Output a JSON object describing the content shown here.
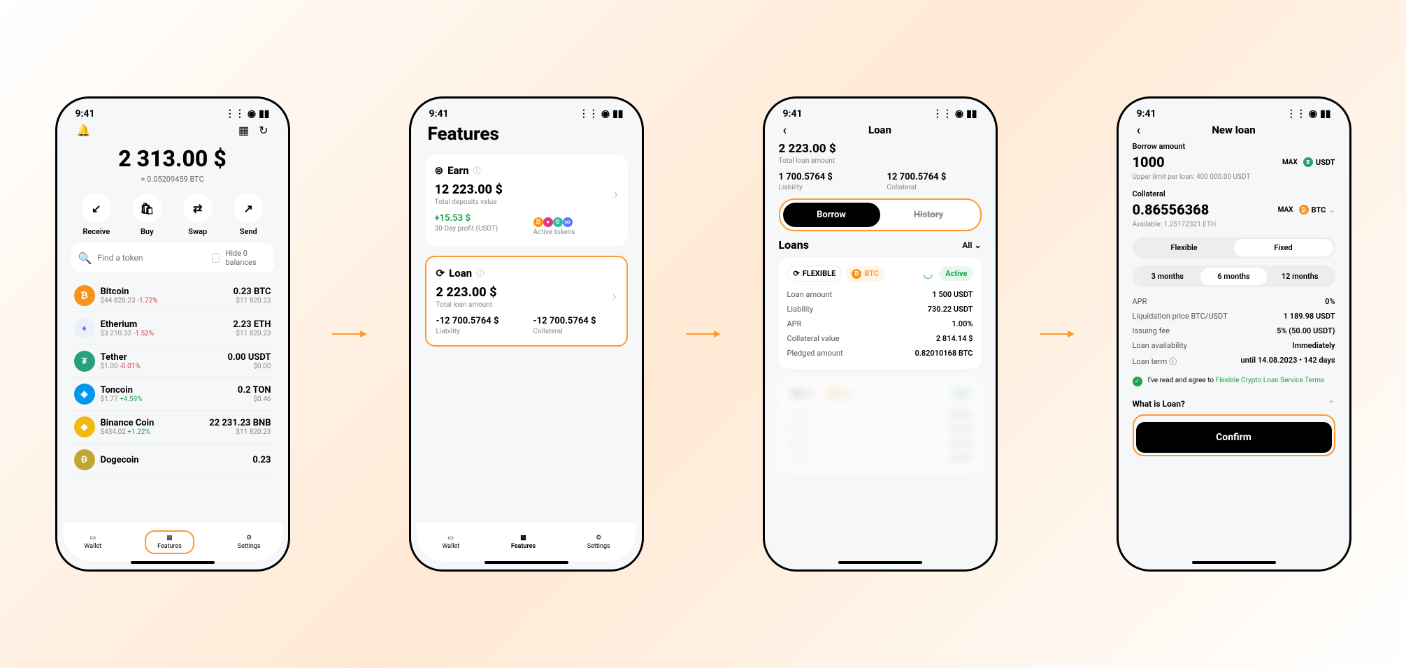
{
  "status": {
    "time": "9:41"
  },
  "wallet": {
    "balance": "2 313.00 $",
    "balance_btc": "≈ 0.05209459 BTC",
    "actions": {
      "receive": "Receive",
      "buy": "Buy",
      "swap": "Swap",
      "send": "Send"
    },
    "search_placeholder": "Find a token",
    "hide_label": "Hide 0 balances",
    "tokens": [
      {
        "name": "Bitcoin",
        "price": "$44 820.23",
        "change": "-1.72%",
        "amt": "0.23 BTC",
        "usd": "$11 820.23",
        "color": "#f7931a",
        "sym": "₿"
      },
      {
        "name": "Etherium",
        "price": "$3 210.32",
        "change": "-1.52%",
        "amt": "2.23 ETH",
        "usd": "$11 820.23",
        "color": "#ecf0f7",
        "sym": "♦"
      },
      {
        "name": "Tether",
        "price": "$1.00",
        "change": "-0.01%",
        "amt": "0.00 USDT",
        "usd": "$0.00",
        "color": "#26a17b",
        "sym": "₮"
      },
      {
        "name": "Toncoin",
        "price": "$1.77",
        "change": "+4.59%",
        "amt": "0.2 TON",
        "usd": "$0.46",
        "color": "#0098ea",
        "sym": "◈"
      },
      {
        "name": "Binance Coin",
        "price": "$434.02",
        "change": "+1.22%",
        "amt": "22 231.23 BNB",
        "usd": "$11 820.23",
        "color": "#f0b90b",
        "sym": "◆"
      },
      {
        "name": "Dogecoin",
        "price": "",
        "change": "",
        "amt": "0.23",
        "usd": "",
        "color": "#c2a633",
        "sym": "Ð"
      }
    ]
  },
  "features": {
    "title": "Features",
    "earn": {
      "title": "Earn",
      "amount": "12 223.00 $",
      "amount_label": "Total deposits value",
      "profit": "+15.53 $",
      "profit_label": "30-Day profit (USDT)",
      "active_label": "Active tokens"
    },
    "loan": {
      "title": "Loan",
      "amount": "2 223.00 $",
      "amount_label": "Total loan amount",
      "liability": "-12 700.5764 $",
      "liability_label": "Liability",
      "collateral": "-12 700.5764 $",
      "collateral_label": "Collateral"
    }
  },
  "loan": {
    "title": "Loan",
    "total": "2 223.00 $",
    "total_label": "Total loan amount",
    "liability": "1 700.5764 $",
    "liability_label": "Liability",
    "collateral": "12 700.5764 $",
    "collateral_label": "Collateral",
    "tab_borrow": "Borrow",
    "tab_history": "History",
    "loans_head": "Loans",
    "filter": "All",
    "chip_flex": "FLEXIBLE",
    "chip_btc": "BTC",
    "chip_active": "Active",
    "rows": [
      {
        "k": "Loan amount",
        "v": "1 500 USDT"
      },
      {
        "k": "Liability",
        "v": "730.22 USDT"
      },
      {
        "k": "APR",
        "v": "1.00%"
      },
      {
        "k": "Collateral value",
        "v": "2 814.14 $"
      },
      {
        "k": "Pledged amount",
        "v": "0.82010168 BTC"
      }
    ]
  },
  "newloan": {
    "title": "New loan",
    "borrow_label": "Borrow amount",
    "borrow_val": "1000",
    "borrow_cur": "USDT",
    "max": "MAX",
    "upper": "Upper limit per loan: 400 000.00 USDT",
    "coll_label": "Collateral",
    "coll_val": "0.86556368",
    "coll_cur": "BTC",
    "avail": "Available: 1.25172321 ETH",
    "seg_type": {
      "flexible": "Flexible",
      "fixed": "Fixed"
    },
    "seg_term": {
      "m3": "3 months",
      "m6": "6 months",
      "m12": "12 months"
    },
    "info": [
      {
        "k": "APR",
        "v": "0%"
      },
      {
        "k": "Liquidation price BTC/USDT",
        "v": "1 189.98 USDT"
      },
      {
        "k": "Issuing fee",
        "v": "5% (50.00 USDT)"
      },
      {
        "k": "Loan availability",
        "v": "Immediately"
      },
      {
        "k": "Loan term ⓘ",
        "v": "until 14.08.2023 • 142 days"
      }
    ],
    "agree_prefix": "I've read and agree to ",
    "agree_link": "Flexible Crypto Loan Service Terms",
    "faq": "What is Loan?",
    "confirm": "Confirm"
  },
  "nav": {
    "wallet": "Wallet",
    "features": "Features",
    "settings": "Settings"
  }
}
